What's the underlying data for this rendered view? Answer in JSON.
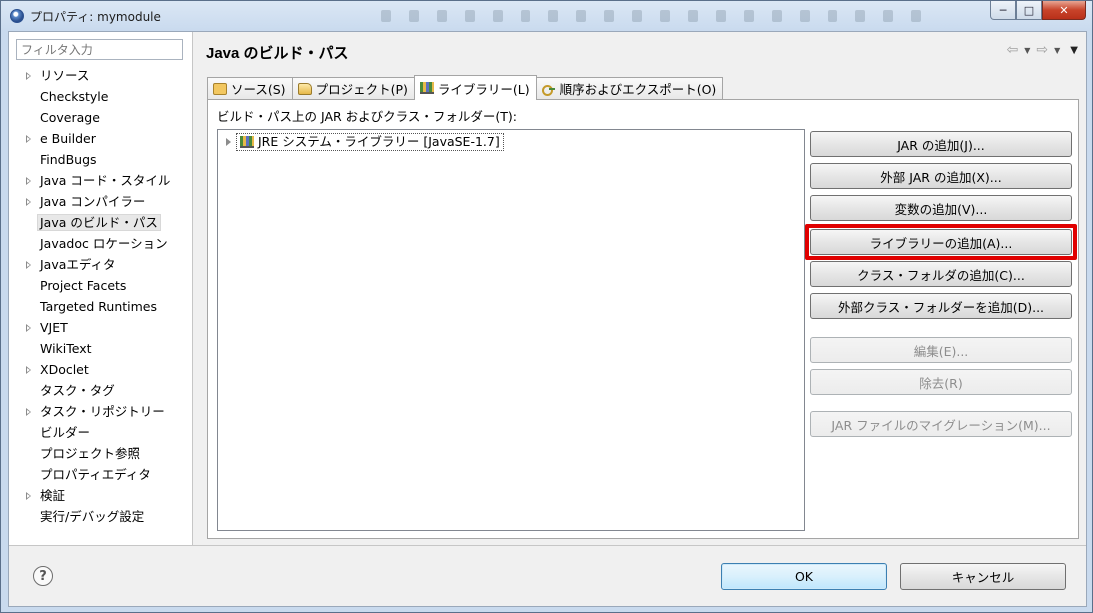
{
  "window": {
    "title": "プロパティ: mymodule",
    "controls": {
      "minimize": "─",
      "maximize": "□",
      "close": "✕"
    }
  },
  "filter": {
    "placeholder": "フィルタ入力"
  },
  "tree": [
    {
      "label": "リソース",
      "expandable": true
    },
    {
      "label": "Checkstyle",
      "expandable": false
    },
    {
      "label": "Coverage",
      "expandable": false
    },
    {
      "label": "e Builder",
      "expandable": true
    },
    {
      "label": "FindBugs",
      "expandable": false
    },
    {
      "label": "Java コード・スタイル",
      "expandable": true
    },
    {
      "label": "Java コンパイラー",
      "expandable": true
    },
    {
      "label": "Java のビルド・パス",
      "expandable": false,
      "selected": true
    },
    {
      "label": "Javadoc ロケーション",
      "expandable": false
    },
    {
      "label": "Javaエディタ",
      "expandable": true
    },
    {
      "label": "Project Facets",
      "expandable": false
    },
    {
      "label": "Targeted Runtimes",
      "expandable": false
    },
    {
      "label": "VJET",
      "expandable": true
    },
    {
      "label": "WikiText",
      "expandable": false
    },
    {
      "label": "XDoclet",
      "expandable": true
    },
    {
      "label": "タスク・タグ",
      "expandable": false
    },
    {
      "label": "タスク・リポジトリー",
      "expandable": true
    },
    {
      "label": "ビルダー",
      "expandable": false
    },
    {
      "label": "プロジェクト参照",
      "expandable": false
    },
    {
      "label": "プロパティエディタ",
      "expandable": false
    },
    {
      "label": "検証",
      "expandable": true
    },
    {
      "label": "実行/デバッグ設定",
      "expandable": false
    }
  ],
  "page": {
    "title": "Java のビルド・パス",
    "nav": {
      "back": "⇦",
      "forward": "⇨",
      "dropdown": "▼",
      "menu": "▼"
    }
  },
  "tabs": [
    {
      "label": "ソース(S)",
      "icon": "source-folder-icon"
    },
    {
      "label": "プロジェクト(P)",
      "icon": "project-icon"
    },
    {
      "label": "ライブラリー(L)",
      "icon": "library-icon",
      "active": true
    },
    {
      "label": "順序およびエクスポート(O)",
      "icon": "order-export-icon"
    }
  ],
  "libraries": {
    "section_label": "ビルド・パス上の JAR およびクラス・フォルダー(T):",
    "items": [
      {
        "label": "JRE システム・ライブラリー [JavaSE-1.7]"
      }
    ]
  },
  "buttons": [
    {
      "label": "JAR の追加(J)...",
      "enabled": true
    },
    {
      "label": "外部 JAR の追加(X)...",
      "enabled": true
    },
    {
      "label": "変数の追加(V)...",
      "enabled": true
    },
    {
      "label": "ライブラリーの追加(A)...",
      "enabled": true,
      "highlighted": true
    },
    {
      "label": "クラス・フォルダの追加(C)...",
      "enabled": true
    },
    {
      "label": "外部クラス・フォルダーを追加(D)...",
      "enabled": true
    },
    {
      "label": "編集(E)...",
      "enabled": false
    },
    {
      "label": "除去(R)",
      "enabled": false
    },
    {
      "label": "JAR ファイルのマイグレーション(M)...",
      "enabled": false
    }
  ],
  "footer": {
    "help": "?",
    "ok": "OK",
    "cancel": "キャンセル"
  },
  "colors": {
    "highlight": "#e00000",
    "selection_bg": "#e8e8e8",
    "default_button_border": "#3c7fb1"
  }
}
